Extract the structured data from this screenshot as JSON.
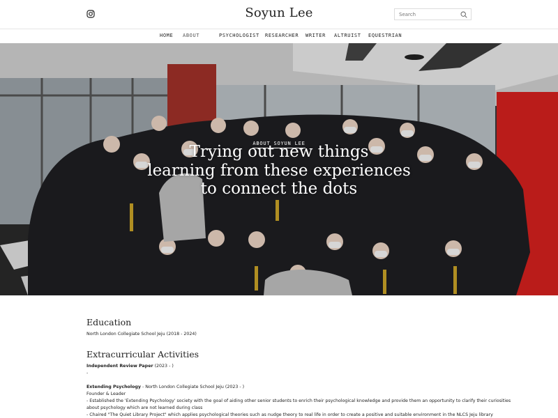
{
  "header": {
    "site_title": "Soyun Lee",
    "instagram_icon": "instagram-icon",
    "search_placeholder": "Search",
    "search_icon": "search-icon"
  },
  "nav": {
    "items": [
      {
        "label": "HOME"
      },
      {
        "label": "ABOUT"
      },
      {
        "label": "PSYCHOLOGIST"
      },
      {
        "label": "RESEARCHER"
      },
      {
        "label": "WRITER"
      },
      {
        "label": "ALTRUIST"
      },
      {
        "label": "EQUESTRIAN"
      }
    ]
  },
  "hero": {
    "tag": "ABOUT SOYUN LEE",
    "headline_lines": [
      "Trying out new things",
      "learning from these experiences",
      "to connect the dots"
    ]
  },
  "education": {
    "title": "Education",
    "entry": "North London Collegiate School Jeju (2018 - 2024)"
  },
  "extracurricular": {
    "title": "Extracurricular Activities",
    "irp_title": "Independent Review Paper",
    "irp_dates": " (2023 - )",
    "irp_dash": "-",
    "ep_title": "Extending Psychology",
    "ep_rest": " - North London Collegiate School Jeju (2023 - )",
    "ep_role": "Founder & Leader",
    "ep_line1": "- Established the 'Extending Psychology' society with the goal of aiding other senior students to enrich their psychological knowledge and provide them an opportunity to clarify their curiosities",
    "ep_line2": "about psychology which are not learned during class",
    "ep_line3": "- Chaired \"The Quiet Library Project\" which applies psychological theories such as nudge theory to real life in order to create a positive and suitable environment in the NLCS Jeju library"
  }
}
